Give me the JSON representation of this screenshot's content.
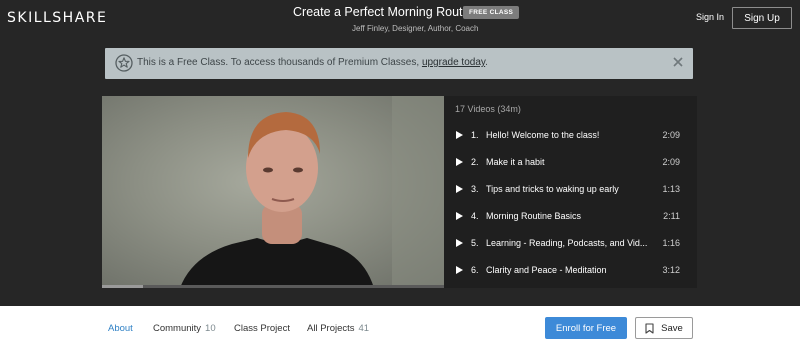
{
  "header": {
    "logo": "SKILLSHARE",
    "course_title": "Create a Perfect Morning Routine",
    "badge": "FREE CLASS",
    "teacher": "Jeff Finley, Designer, Author, Coach",
    "sign_in": "Sign In",
    "sign_up": "Sign Up"
  },
  "banner": {
    "text": "This is a Free Class. To access thousands of Premium Classes,",
    "link": "upgrade today",
    "suffix": "."
  },
  "video": {
    "progress": 0.12
  },
  "playlist": {
    "header": "17 Videos (34m)",
    "items": [
      {
        "num": "1.",
        "title": "Hello! Welcome to the class!",
        "duration": "2:09",
        "active": true
      },
      {
        "num": "2.",
        "title": "Make it a habit",
        "duration": "2:09",
        "active": false
      },
      {
        "num": "3.",
        "title": "Tips and tricks to waking up early",
        "duration": "1:13",
        "active": false
      },
      {
        "num": "4.",
        "title": "Morning Routine Basics",
        "duration": "2:11",
        "active": false
      },
      {
        "num": "5.",
        "title": "Learning - Reading, Podcasts, and Vid...",
        "duration": "1:16",
        "active": false
      },
      {
        "num": "6.",
        "title": "Clarity and Peace - Meditation",
        "duration": "3:12",
        "active": false
      }
    ]
  },
  "tabs": {
    "about": "About",
    "community": "Community",
    "community_count": "10",
    "class_project": "Class Project",
    "all_projects": "All Projects",
    "all_projects_count": "41"
  },
  "actions": {
    "enroll": "Enroll for Free",
    "save": "Save"
  },
  "icons": [
    "star-icon",
    "close-icon",
    "play-icon",
    "bookmark-icon"
  ],
  "colors": {
    "accent": "#3d8ad8",
    "active_tab": "#3182c6",
    "banner_bg": "#b9c2c5",
    "page_bg": "#262626"
  }
}
